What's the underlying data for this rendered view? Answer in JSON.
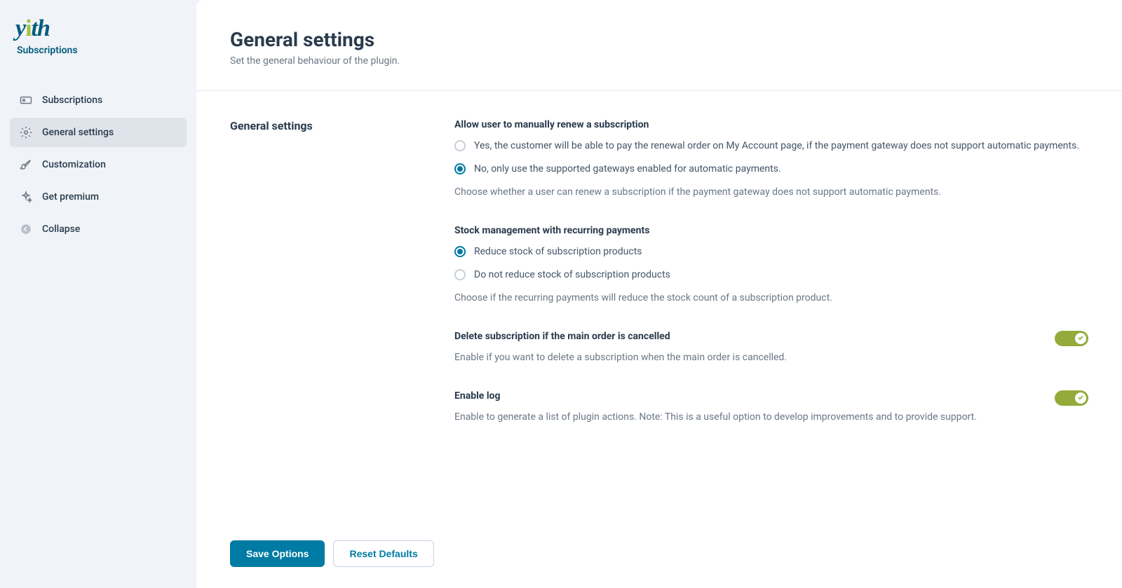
{
  "brand": {
    "logo_text": "yith",
    "sub_text": "Subscriptions"
  },
  "sidebar": {
    "items": [
      {
        "label": "Subscriptions"
      },
      {
        "label": "General settings"
      },
      {
        "label": "Customization"
      },
      {
        "label": "Get premium"
      },
      {
        "label": "Collapse"
      }
    ]
  },
  "page": {
    "title": "General settings",
    "description": "Set the general behaviour of the plugin."
  },
  "section": {
    "heading": "General settings"
  },
  "fields": {
    "renew": {
      "title": "Allow user to manually renew a subscription",
      "option_yes": "Yes, the customer will be able to pay the renewal order on My Account page, if the payment gateway does not support automatic payments.",
      "option_no": "No, only use the supported gateways enabled for automatic payments.",
      "help": "Choose whether a user can renew a subscription if the payment gateway does not support automatic payments."
    },
    "stock": {
      "title": "Stock management with recurring payments",
      "option_reduce": "Reduce stock of subscription products",
      "option_noreduce": "Do not reduce stock of subscription products",
      "help": "Choose if the recurring payments will reduce the stock count of a subscription product."
    },
    "delete": {
      "title": "Delete subscription if the main order is cancelled",
      "help": "Enable if you want to delete a subscription when the main order is cancelled."
    },
    "log": {
      "title": "Enable log",
      "help": "Enable to generate a list of plugin actions. Note: This is a useful option to develop improvements and to provide support."
    }
  },
  "footer": {
    "save": "Save Options",
    "reset": "Reset Defaults"
  }
}
